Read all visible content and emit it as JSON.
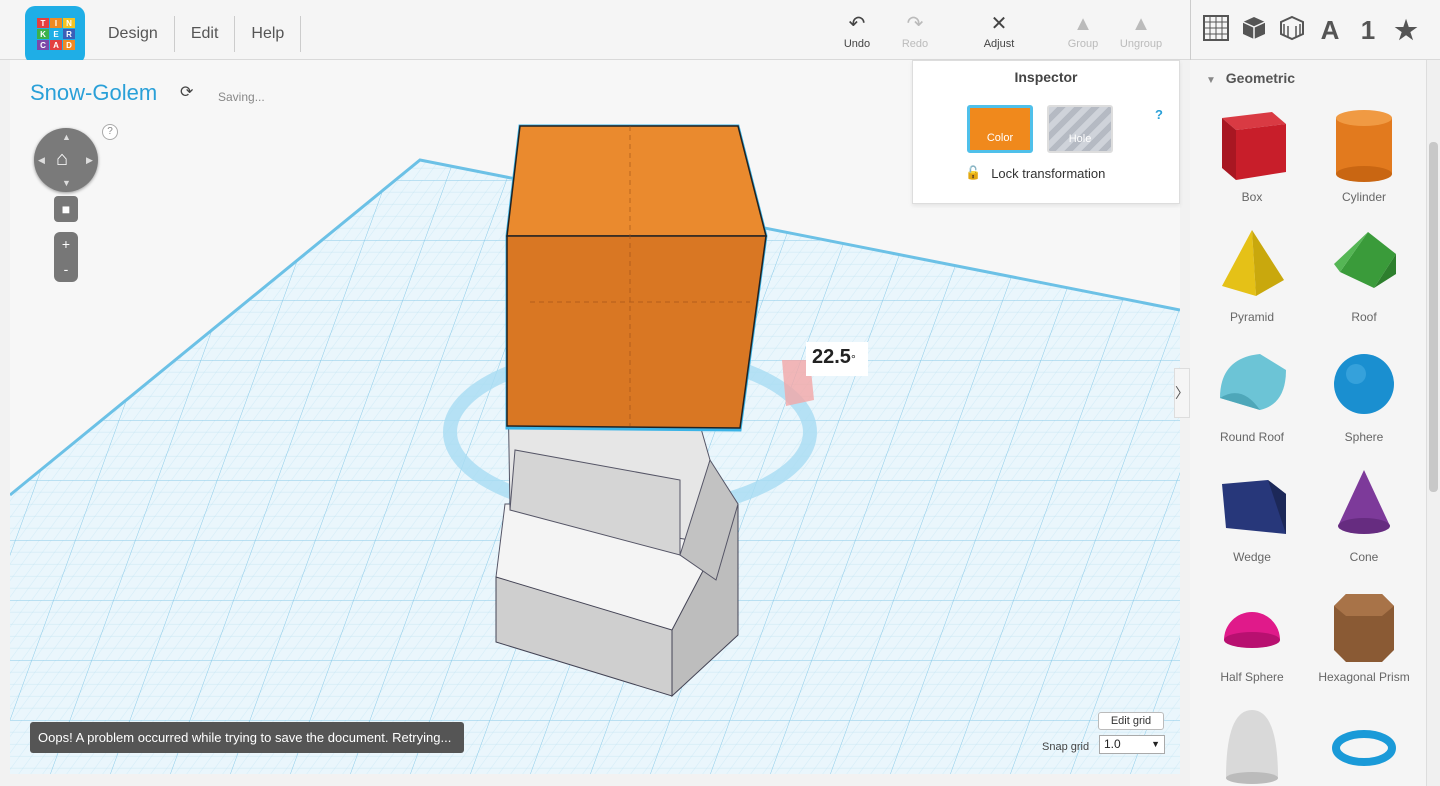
{
  "app": {
    "logo_letters": [
      "T",
      "I",
      "N",
      "K",
      "E",
      "R",
      "C",
      "A",
      "D"
    ]
  },
  "menu": {
    "items": [
      "Design",
      "Edit",
      "Help"
    ]
  },
  "toolbar": {
    "undo": "Undo",
    "redo": "Redo",
    "adjust": "Adjust",
    "group": "Group",
    "ungroup": "Ungroup"
  },
  "library_tabs": [
    "grid-icon",
    "box-icon",
    "texture-icon",
    "letter-a-icon",
    "number-1-icon",
    "star-icon"
  ],
  "library_tab_glyphs": {
    "letter": "A",
    "number": "1"
  },
  "document": {
    "title": "Snow-Golem",
    "status": "Saving..."
  },
  "view_controls": {
    "help": "?",
    "zoom_in": "+",
    "zoom_out": "-"
  },
  "inspector": {
    "title": "Inspector",
    "help": "?",
    "color_label": "Color",
    "hole_label": "Hole",
    "lock_label": "Lock transformation",
    "color": "#f0891c"
  },
  "scene": {
    "rotation_readout": "22.5",
    "rotation_unit": "°"
  },
  "grid_controls": {
    "edit_grid": "Edit grid",
    "snap_label": "Snap grid",
    "snap_value": "1.0"
  },
  "toast": {
    "message": "Oops! A problem occurred while trying to save the document. Retrying..."
  },
  "library": {
    "category": "Geometric",
    "shapes": [
      {
        "label": "Box",
        "icon": "box-shape-icon",
        "color": "#c81e2a"
      },
      {
        "label": "Cylinder",
        "icon": "cylinder-shape-icon",
        "color": "#e27a1e"
      },
      {
        "label": "Pyramid",
        "icon": "pyramid-shape-icon",
        "color": "#e5c117"
      },
      {
        "label": "Roof",
        "icon": "roof-shape-icon",
        "color": "#3a9b3a"
      },
      {
        "label": "Round Roof",
        "icon": "round-roof-shape-icon",
        "color": "#6cc4d6"
      },
      {
        "label": "Sphere",
        "icon": "sphere-shape-icon",
        "color": "#1a8fd0"
      },
      {
        "label": "Wedge",
        "icon": "wedge-shape-icon",
        "color": "#27377a"
      },
      {
        "label": "Cone",
        "icon": "cone-shape-icon",
        "color": "#7d3a9a"
      },
      {
        "label": "Half Sphere",
        "icon": "half-sphere-shape-icon",
        "color": "#e01a8a"
      },
      {
        "label": "Hexagonal Prism",
        "icon": "hexagonal-prism-shape-icon",
        "color": "#8a5a34"
      },
      {
        "label": "",
        "icon": "paraboloid-shape-icon",
        "color": "#d9d9d9"
      },
      {
        "label": "",
        "icon": "torus-shape-icon",
        "color": "#1a9ad8"
      }
    ]
  }
}
